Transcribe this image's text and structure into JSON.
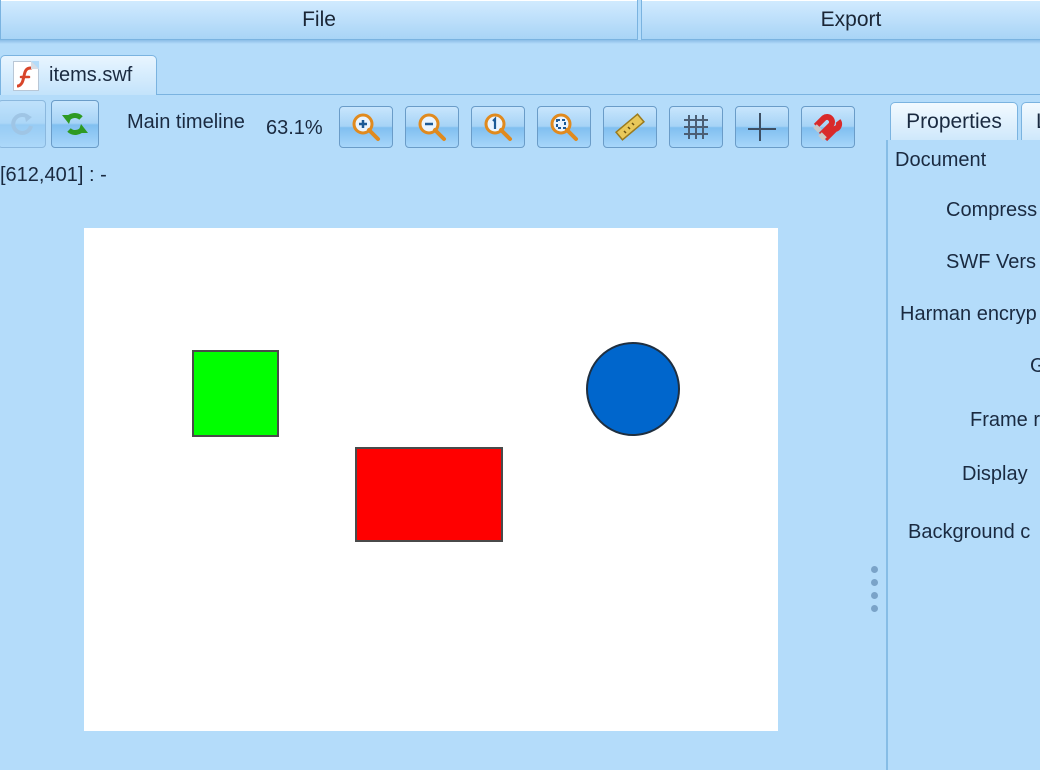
{
  "menu": {
    "file_label": "File",
    "export_label": "Export"
  },
  "document_tab": {
    "filename": "items.swf"
  },
  "toolbar": {
    "timeline_label": "Main timeline",
    "zoom_level": "63.1%"
  },
  "status": {
    "coords": "[612,401] :  -"
  },
  "stage": {
    "background": "#ffffff",
    "shapes": [
      {
        "type": "square",
        "color": "#00ff00"
      },
      {
        "type": "circle",
        "color": "#0066cc"
      },
      {
        "type": "rectangle",
        "color": "#ff0000"
      }
    ]
  },
  "properties_panel": {
    "tab_properties": "Properties",
    "tab_second": "L",
    "section": "Document",
    "rows": [
      {
        "label": "Compress"
      },
      {
        "label": "SWF Vers"
      },
      {
        "label": "Harman encryp"
      },
      {
        "label": "G"
      },
      {
        "label": "Frame r"
      },
      {
        "label": "Display"
      },
      {
        "label": "Background c"
      }
    ]
  }
}
